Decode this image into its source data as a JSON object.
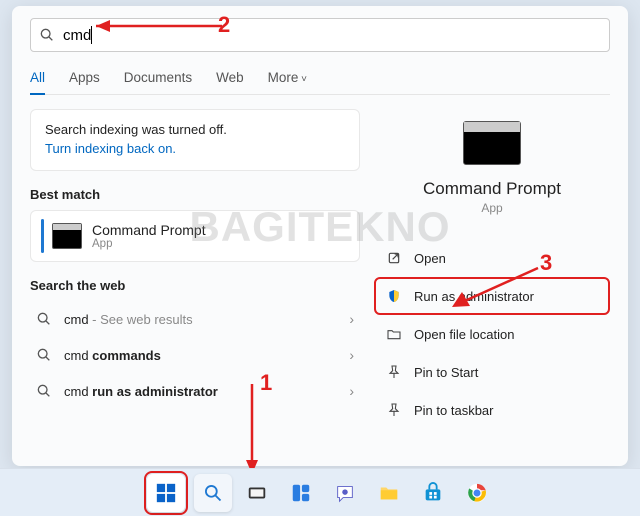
{
  "search": {
    "query": "cmd",
    "placeholder": ""
  },
  "tabs": [
    "All",
    "Apps",
    "Documents",
    "Web",
    "More"
  ],
  "indexing": {
    "msg": "Search indexing was turned off.",
    "link": "Turn indexing back on."
  },
  "bestMatch": {
    "heading": "Best match",
    "title": "Command Prompt",
    "sub": "App"
  },
  "webHeading": "Search the web",
  "web": [
    {
      "query": "cmd",
      "hint": " - See web results"
    },
    {
      "query": "cmd ",
      "bold": "commands",
      "hint": ""
    },
    {
      "query": "cmd ",
      "bold": "run as administrator",
      "hint": ""
    }
  ],
  "preview": {
    "title": "Command Prompt",
    "sub": "App"
  },
  "actions": {
    "open": "Open",
    "runAdmin": "Run as administrator",
    "openLoc": "Open file location",
    "pinStart": "Pin to Start",
    "pinTaskbar": "Pin to taskbar"
  },
  "steps": {
    "s1": "1",
    "s2": "2",
    "s3": "3"
  },
  "watermark": "BAGITEKNO"
}
